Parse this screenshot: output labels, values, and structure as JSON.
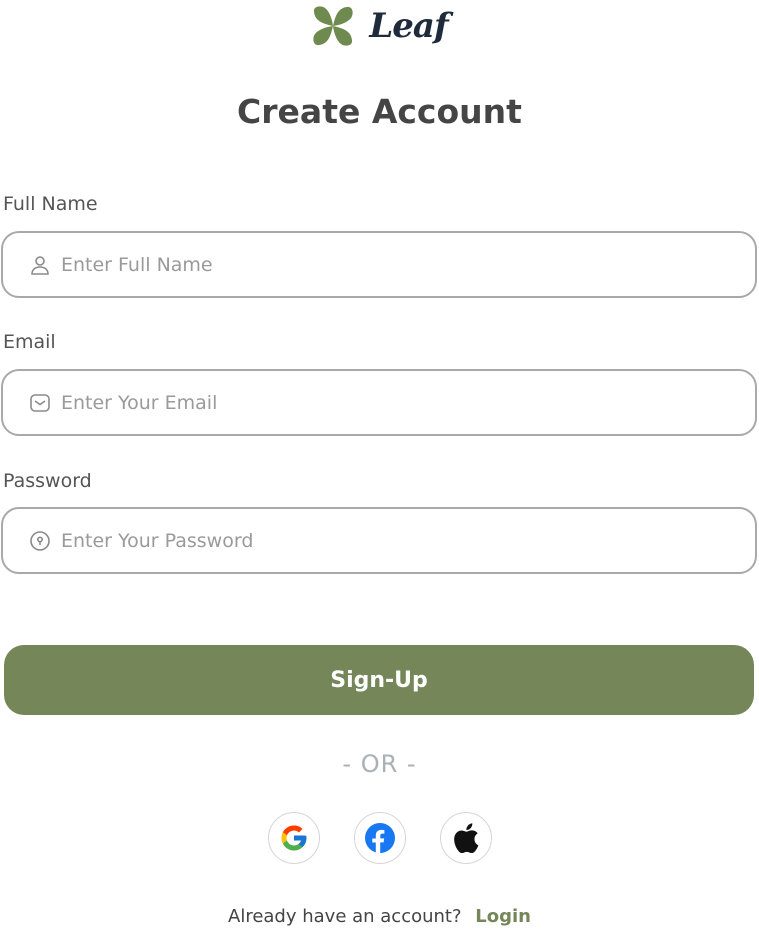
{
  "brand": {
    "name": "Leaf",
    "color": "#758659"
  },
  "page_title": "Create Account",
  "form": {
    "full_name": {
      "label": "Full Name",
      "placeholder": "Enter Full Name",
      "value": "",
      "icon": "user-icon"
    },
    "email": {
      "label": "Email",
      "placeholder": "Enter Your Email",
      "value": "",
      "icon": "mail-icon"
    },
    "password": {
      "label": "Password",
      "placeholder": "Enter Your Password",
      "value": "",
      "icon": "lock-icon"
    }
  },
  "signup_button": {
    "label": "Sign-Up",
    "color": "#758659"
  },
  "divider_text": "- OR -",
  "social": [
    {
      "name": "google-icon"
    },
    {
      "name": "facebook-icon"
    },
    {
      "name": "apple-icon"
    }
  ],
  "footer": {
    "text": "Already have an account?",
    "link": "Login"
  }
}
